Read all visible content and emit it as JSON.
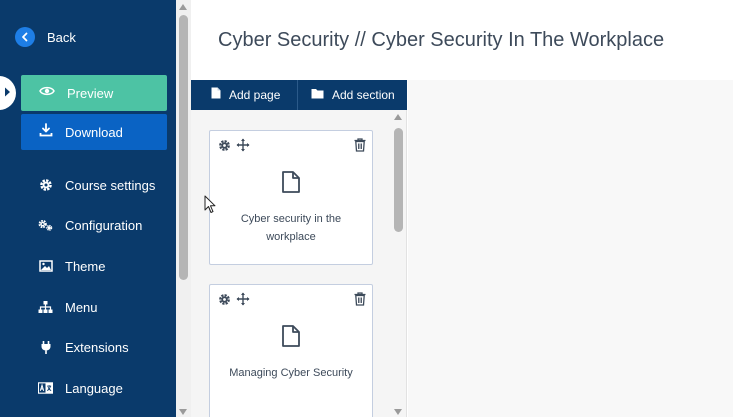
{
  "sidebar": {
    "back_label": "Back",
    "preview_label": "Preview",
    "download_label": "Download",
    "nav_items": [
      {
        "label": "Course settings",
        "icon": "gear-icon"
      },
      {
        "label": "Configuration",
        "icon": "gears-icon"
      },
      {
        "label": "Theme",
        "icon": "image-icon"
      },
      {
        "label": "Menu",
        "icon": "sitemap-icon"
      },
      {
        "label": "Extensions",
        "icon": "plug-icon"
      },
      {
        "label": "Language",
        "icon": "language-icon"
      }
    ]
  },
  "header": {
    "title": "Cyber Security // Cyber Security In The Workplace"
  },
  "toolbar": {
    "add_page_label": "Add page",
    "add_section_label": "Add section"
  },
  "pages": [
    {
      "title": "Cyber security in the workplace"
    },
    {
      "title": "Managing Cyber Security"
    }
  ],
  "colors": {
    "sidebar_bg": "#0a3a6b",
    "preview_green": "#4dc3a4",
    "download_blue": "#0a63c4",
    "accent_blue": "#1e7ee6",
    "title_text": "#3d4a5a"
  }
}
